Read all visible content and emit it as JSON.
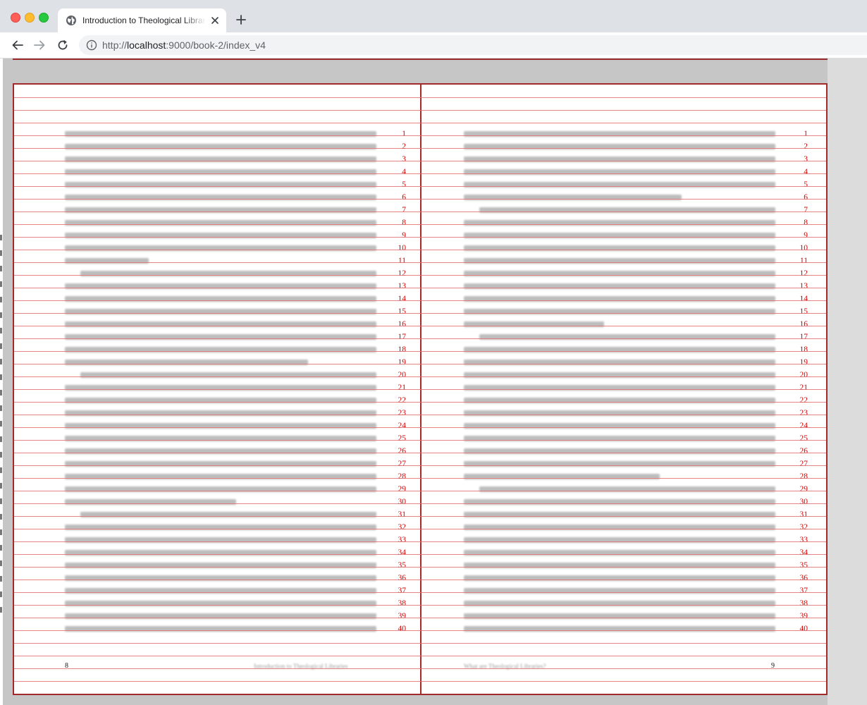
{
  "browser": {
    "tab_title": "Introduction to Theological Librarianship",
    "url_scheme": "http://",
    "url_host": "localhost",
    "url_path": ":9000/book-2/index_v4"
  },
  "book": {
    "left_page": {
      "folio": "8",
      "running_head": "Introduction to Theological Libraries"
    },
    "right_page": {
      "folio": "9",
      "running_head": "What are Theological Libraries?"
    },
    "line_numbers": [
      "1",
      "2",
      "3",
      "4",
      "5",
      "6",
      "7",
      "8",
      "9",
      "10",
      "11",
      "12",
      "13",
      "14",
      "15",
      "16",
      "17",
      "18",
      "19",
      "20",
      "21",
      "22",
      "23",
      "24",
      "25",
      "26",
      "27",
      "28",
      "29",
      "30",
      "31",
      "32",
      "33",
      "34",
      "35",
      "36",
      "37",
      "38",
      "39",
      "40"
    ]
  }
}
